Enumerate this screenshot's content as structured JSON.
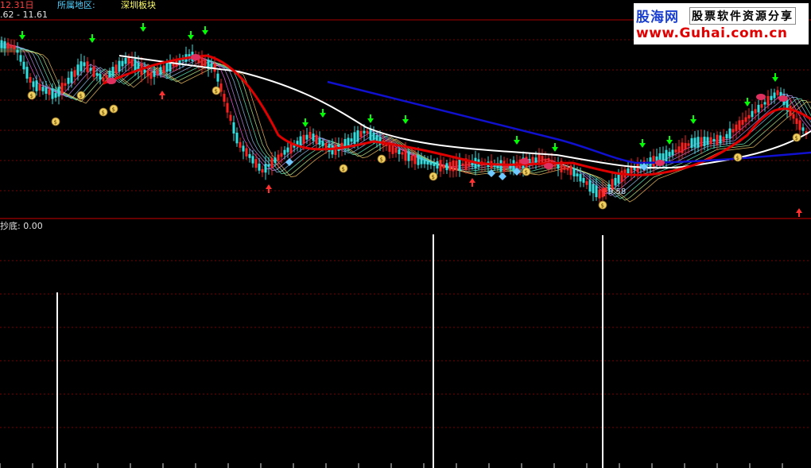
{
  "header": {
    "date_label": "12.31日",
    "region_label": "所属地区:",
    "region_value": "深圳板块",
    "price_range": ".62 - 11.61"
  },
  "indicator": {
    "label": "抄底: 0.00"
  },
  "low_price_marker": "9.58",
  "watermark": {
    "brand": "股海网",
    "slogan": "股票软件资源分享",
    "url": "www.Guhai.com.cn"
  },
  "colors": {
    "background": "#000000",
    "grid_red": "#7a0000",
    "up_candle": "#ff2020",
    "down_candle": "#30e0e0",
    "ma_red": "#e00000",
    "ma_white": "#ffffff",
    "ma_blue": "#1010d0",
    "label_yellow": "#ffff66",
    "label_cyan": "#4fd0ff",
    "signal_green": "#00ff00",
    "indicator_bar": "#ffffff"
  },
  "icons": [
    "money-bag-icon",
    "down-arrow-icon",
    "up-arrow-icon",
    "diamond-icon",
    "lips-icon"
  ]
}
